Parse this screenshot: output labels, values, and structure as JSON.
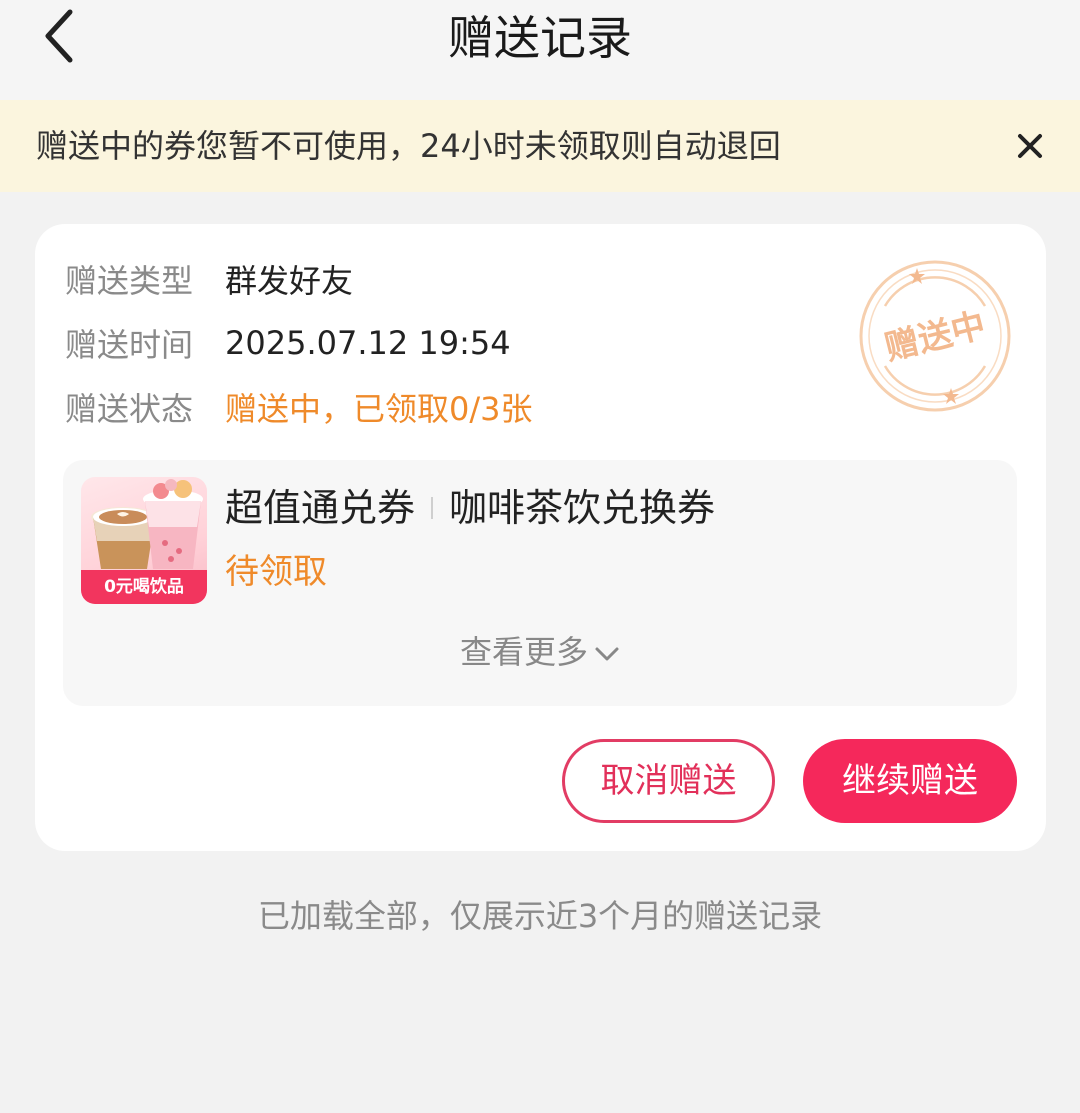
{
  "header": {
    "title": "赠送记录",
    "back_icon": "chevron-left-icon"
  },
  "notice": {
    "text": "赠送中的券您暂不可使用，24小时未领取则自动退回",
    "close_icon": "close-icon"
  },
  "record": {
    "type_label": "赠送类型",
    "type_value": "群发好友",
    "time_label": "赠送时间",
    "time_value": "2025.07.12 19:54",
    "status_label": "赠送状态",
    "status_value": "赠送中，已领取0/3张",
    "stamp_text": "赠送中",
    "coupon": {
      "thumb_caption": "0元喝饮品",
      "name": "超值通兑券",
      "subtitle": "咖啡茶饮兑换券",
      "status": "待领取"
    },
    "see_more": "查看更多",
    "cancel_button": "取消赠送",
    "continue_button": "继续赠送"
  },
  "footer": {
    "note": "已加载全部，仅展示近3个月的赠送记录"
  },
  "colors": {
    "accent": "#f5285b",
    "status_orange": "#ef8a2a",
    "notice_bg": "#fbf5de",
    "stamp": "#f3b98f"
  }
}
